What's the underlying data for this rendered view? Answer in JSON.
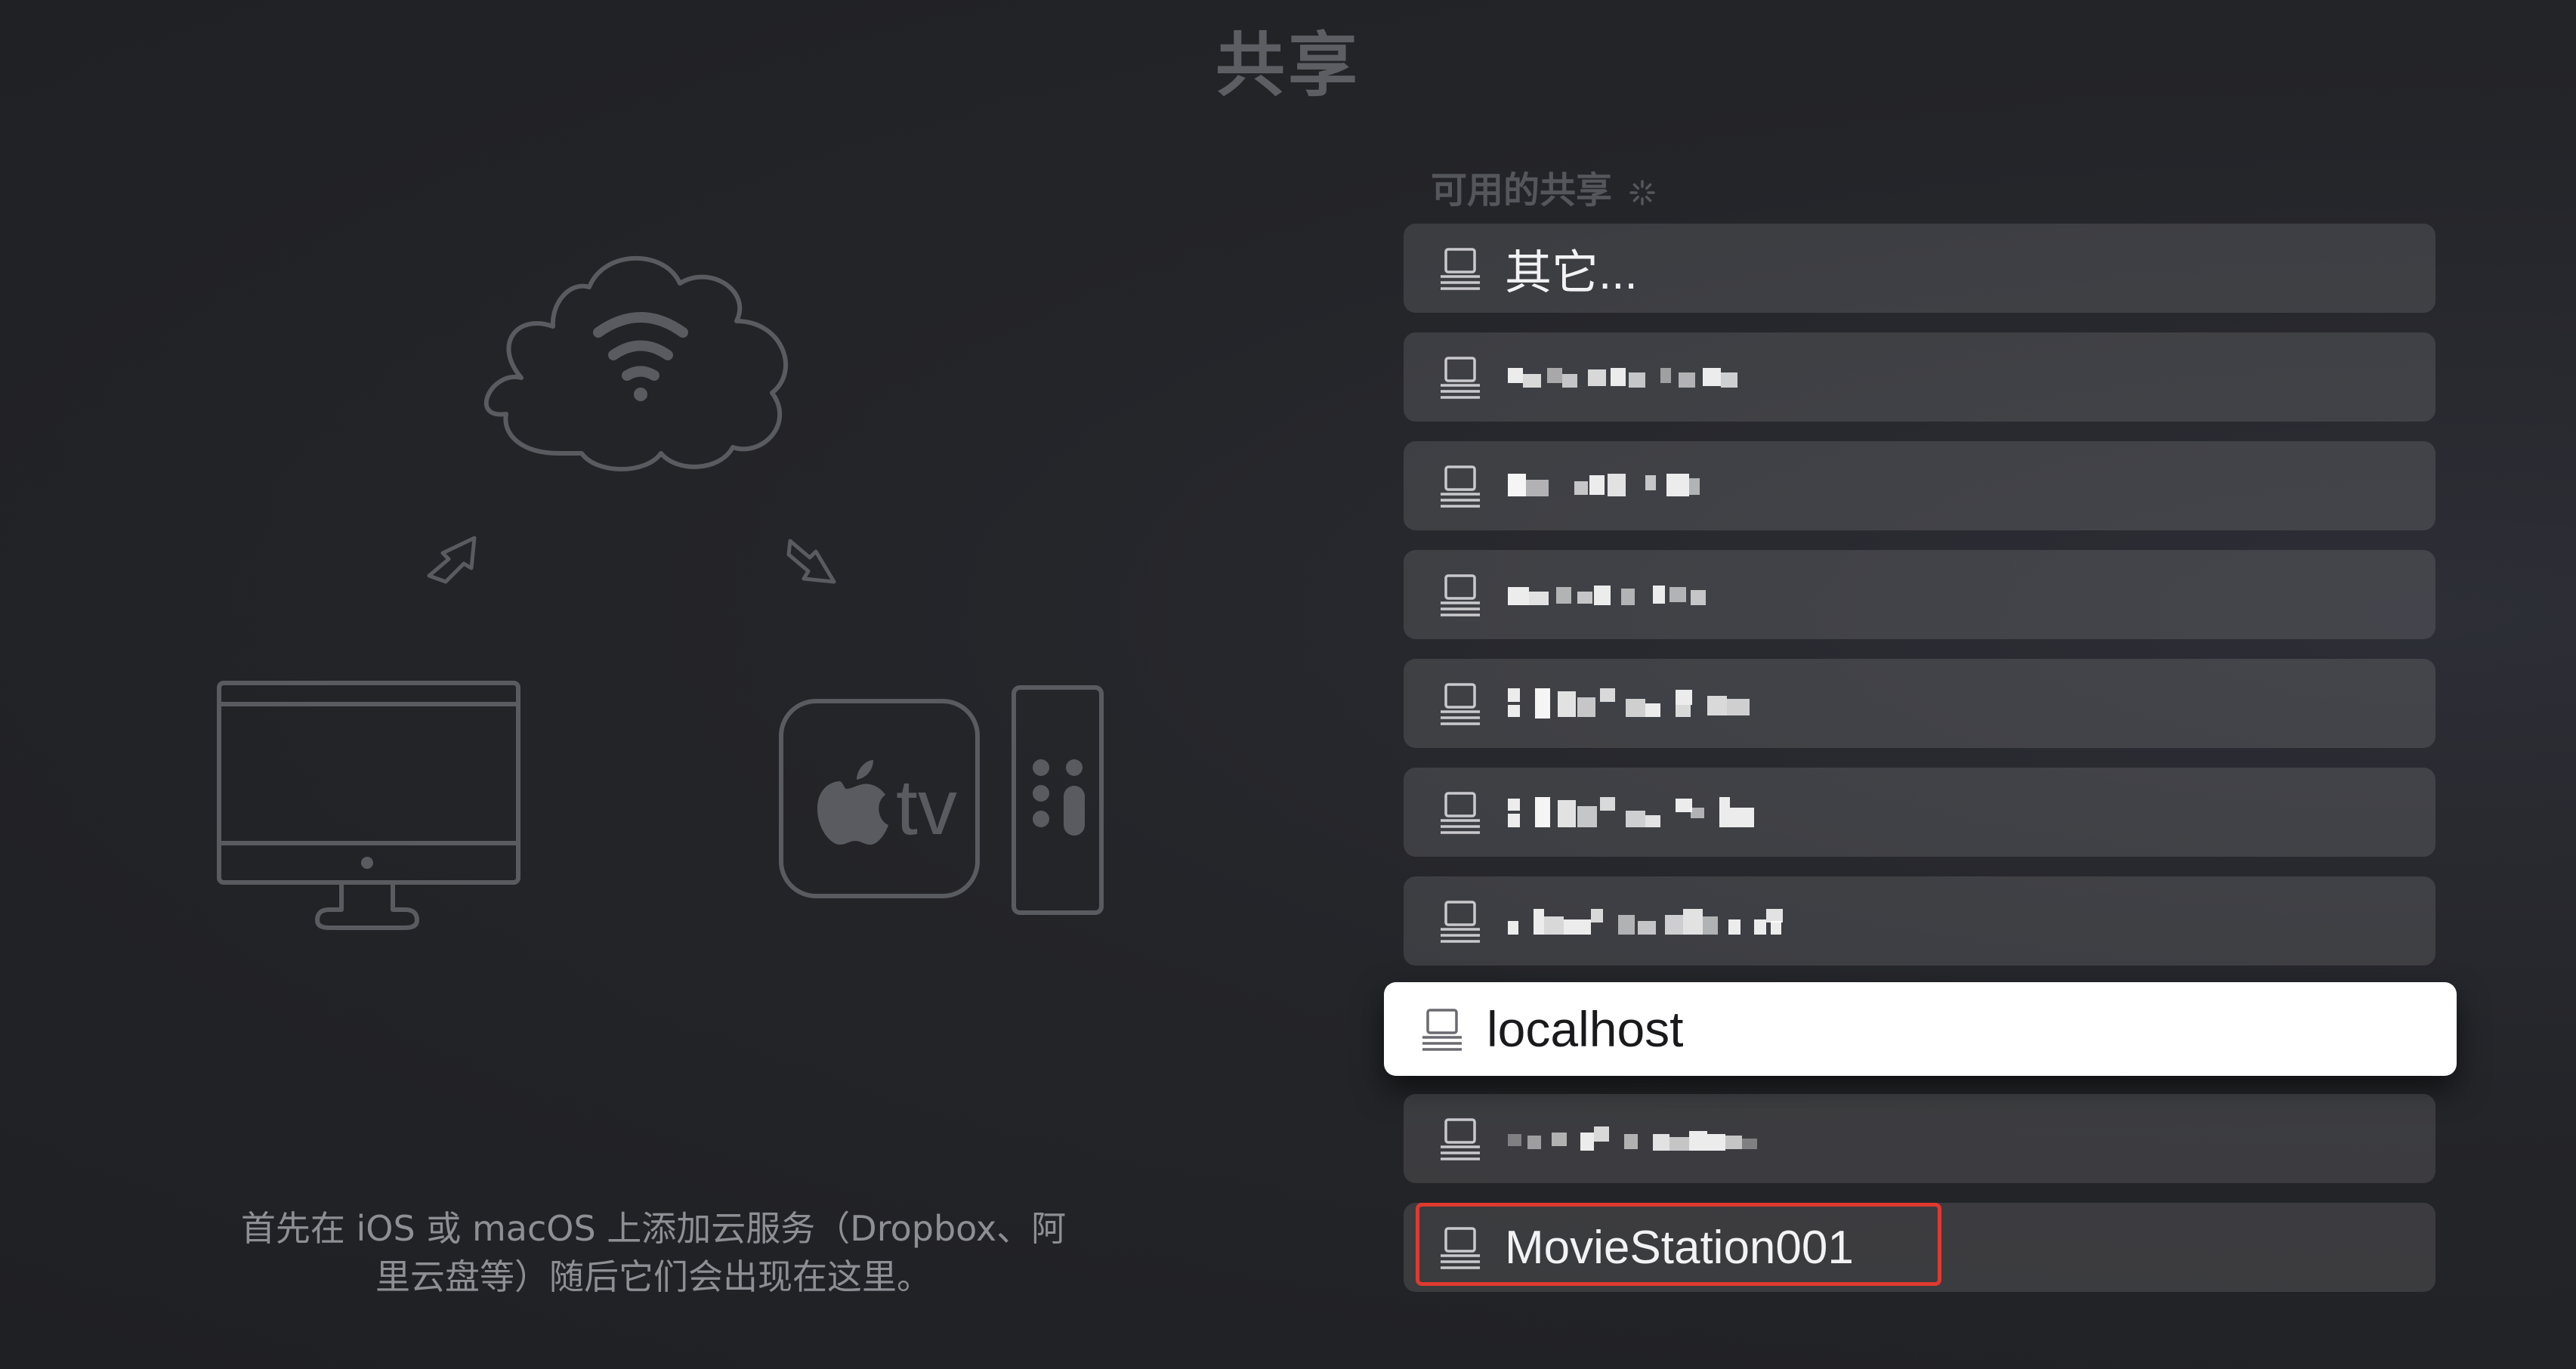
{
  "page": {
    "title": "共享"
  },
  "illustration": {
    "instructions_line1": "首先在 iOS 或 macOS 上添加云服务（Dropbox、阿",
    "instructions_line2": "里云盘等）随后它们会出现在这里。",
    "icons": [
      "cloud-wifi-icon",
      "arrow-up-right-icon",
      "arrow-down-right-icon",
      "imac-icon",
      "apple-tv-icon",
      "siri-remote-icon"
    ],
    "apple_tv_text": "tv"
  },
  "shares": {
    "header": "可用的共享",
    "header_icon": "spinner-icon",
    "items": [
      {
        "label": "其它...",
        "icon": "server-icon",
        "obscured": false,
        "focused": false
      },
      {
        "label": "",
        "icon": "server-icon",
        "obscured": true,
        "focused": false
      },
      {
        "label": "",
        "icon": "server-icon",
        "obscured": true,
        "focused": false
      },
      {
        "label": "",
        "icon": "server-icon",
        "obscured": true,
        "focused": false
      },
      {
        "label": "",
        "icon": "server-icon",
        "obscured": true,
        "focused": false
      },
      {
        "label": "",
        "icon": "server-icon",
        "obscured": true,
        "focused": false
      },
      {
        "label": "",
        "icon": "server-icon",
        "obscured": true,
        "focused": false
      },
      {
        "label": "localhost",
        "icon": "server-icon",
        "obscured": false,
        "focused": true
      },
      {
        "label": "",
        "icon": "server-icon",
        "obscured": true,
        "focused": false
      },
      {
        "label": "MovieStation001",
        "icon": "server-icon",
        "obscured": false,
        "focused": false,
        "highlighted": true
      }
    ]
  },
  "colors": {
    "background": "#242529",
    "row": "#3a3b40",
    "focused_row": "#ffffff",
    "highlight_border": "#e0392f",
    "illustration_stroke": "#5a5b60"
  }
}
